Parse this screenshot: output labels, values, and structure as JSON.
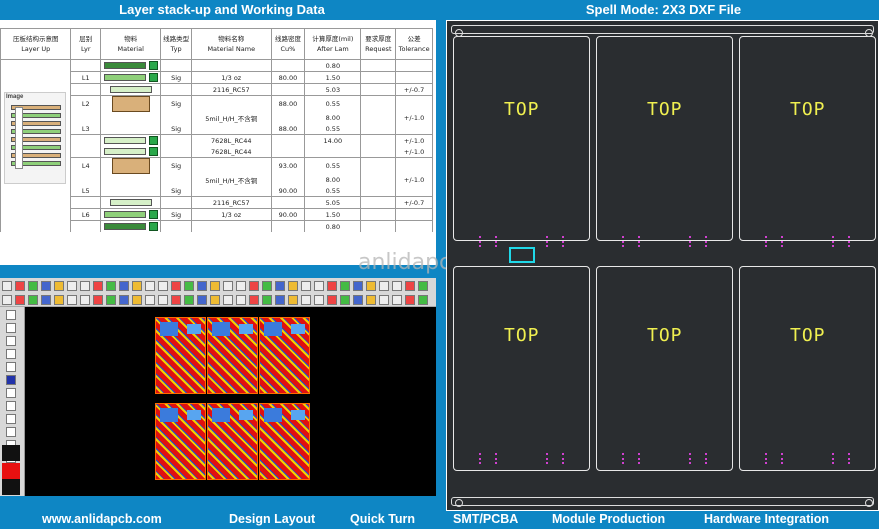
{
  "headers": {
    "left": "Layer stack-up and Working Data",
    "right": "Spell Mode: 2X3  DXF File"
  },
  "table": {
    "columns": [
      {
        "cn": "压板结构示意图",
        "en": "Layer Up"
      },
      {
        "cn": "层别",
        "en": "Lyr"
      },
      {
        "cn": "物料",
        "en": "Material"
      },
      {
        "cn": "线路类型",
        "en": "Typ"
      },
      {
        "cn": "物料名称",
        "en": "Material Name"
      },
      {
        "cn": "线路密度",
        "en": "Cu%"
      },
      {
        "cn": "计算厚度(mil)",
        "en": "After Lam"
      },
      {
        "cn": "要求厚度",
        "en": "Request"
      },
      {
        "cn": "公差",
        "en": "Tolerance"
      }
    ],
    "image_label": "Image",
    "rows": [
      {
        "lyr": "",
        "mat": "dkgreen",
        "typ": "",
        "name": "",
        "cu": "",
        "lam": "0.80",
        "tol": "",
        "sep": true,
        "mark": true
      },
      {
        "lyr": "L1",
        "mat": "green",
        "typ": "Sig",
        "name": "1/3 oz",
        "cu": "80.00",
        "lam": "1.50",
        "tol": "",
        "sep": true,
        "mark": true
      },
      {
        "lyr": "",
        "mat": "lt",
        "typ": "",
        "name": "2116_RC57",
        "cu": "",
        "lam": "5.03",
        "tol": "+/-0.7",
        "sep": true,
        "mark": false
      },
      {
        "lyr": "L2",
        "mat": "core",
        "typ": "Sig",
        "name": "",
        "cu": "88.00",
        "lam": "0.55",
        "tol": "",
        "sep": true,
        "mark": false
      },
      {
        "lyr": "",
        "mat": "",
        "typ": "",
        "name": "5mil_H/H_不含铜",
        "cu": "",
        "lam": "8.00",
        "tol": "+/-1.0",
        "sep": false,
        "mark": false
      },
      {
        "lyr": "L3",
        "mat": "",
        "typ": "Sig",
        "name": "",
        "cu": "88.00",
        "lam": "0.55",
        "tol": "",
        "sep": false,
        "mark": false
      },
      {
        "lyr": "",
        "mat": "lt",
        "typ": "",
        "name": "7628L_RC44",
        "cu": "",
        "lam": "14.00",
        "tol": "+/-1.0",
        "sep": true,
        "mark": true
      },
      {
        "lyr": "",
        "mat": "lt",
        "typ": "",
        "name": "7628L_RC44",
        "cu": "",
        "lam": "",
        "tol": "+/-1.0",
        "sep": false,
        "mark": true
      },
      {
        "lyr": "L4",
        "mat": "core",
        "typ": "Sig",
        "name": "",
        "cu": "93.00",
        "lam": "0.55",
        "tol": "",
        "sep": true,
        "mark": false
      },
      {
        "lyr": "",
        "mat": "",
        "typ": "",
        "name": "5mil_H/H_不含铜",
        "cu": "",
        "lam": "8.00",
        "tol": "+/-1.0",
        "sep": false,
        "mark": false
      },
      {
        "lyr": "L5",
        "mat": "",
        "typ": "Sig",
        "name": "",
        "cu": "90.00",
        "lam": "0.55",
        "tol": "",
        "sep": false,
        "mark": false
      },
      {
        "lyr": "",
        "mat": "lt",
        "typ": "",
        "name": "2116_RC57",
        "cu": "",
        "lam": "5.05",
        "tol": "+/-0.7",
        "sep": true,
        "mark": false
      },
      {
        "lyr": "L6",
        "mat": "green",
        "typ": "Sig",
        "name": "1/3 oz",
        "cu": "90.00",
        "lam": "1.50",
        "tol": "",
        "sep": true,
        "mark": true
      },
      {
        "lyr": "",
        "mat": "dkgreen",
        "typ": "",
        "name": "",
        "cu": "",
        "lam": "0.80",
        "tol": "",
        "sep": true,
        "mark": true
      }
    ]
  },
  "dxf": {
    "top_label": "TOP",
    "cells": 6
  },
  "watermark": "anlidapcb.com",
  "footer": [
    "www.anlidapcb.com",
    "Design Layout",
    "Quick Turn",
    "SMT/PCBA",
    "Module Production",
    "Hardware Integration"
  ]
}
